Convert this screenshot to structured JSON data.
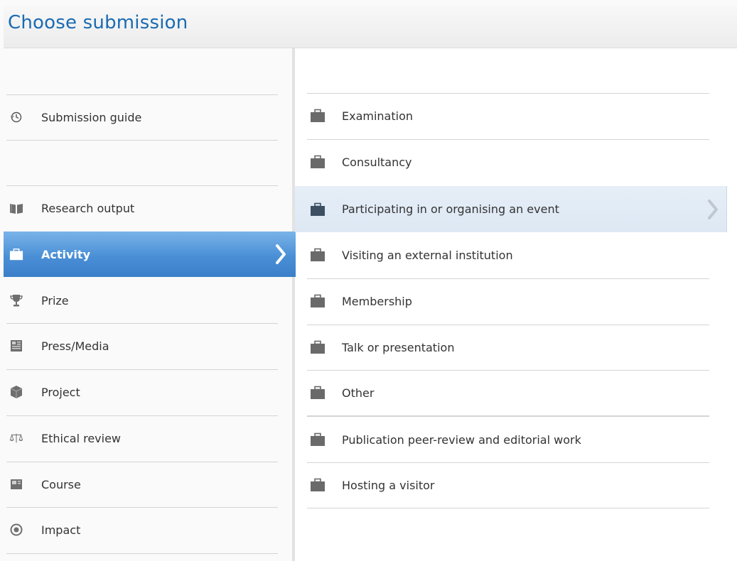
{
  "header": {
    "title": "Choose submission"
  },
  "left_menu": {
    "items": [
      {
        "label": "Submission guide",
        "icon": "clock-back-icon"
      },
      {
        "label": "Research output",
        "icon": "book-icon"
      },
      {
        "label": "Activity",
        "icon": "briefcase-icon",
        "active": true
      },
      {
        "label": "Prize",
        "icon": "trophy-icon"
      },
      {
        "label": "Press/Media",
        "icon": "newspaper-icon"
      },
      {
        "label": "Project",
        "icon": "cube-icon"
      },
      {
        "label": "Ethical review",
        "icon": "scales-icon"
      },
      {
        "label": "Course",
        "icon": "course-icon"
      },
      {
        "label": "Impact",
        "icon": "target-icon"
      }
    ]
  },
  "right_menu": {
    "items": [
      {
        "label": "Examination",
        "icon": "briefcase-icon"
      },
      {
        "label": "Consultancy",
        "icon": "briefcase-icon"
      },
      {
        "label": "Participating in or organising an event",
        "icon": "briefcase-icon",
        "hovered": true
      },
      {
        "label": "Visiting an external institution",
        "icon": "briefcase-icon"
      },
      {
        "label": "Membership",
        "icon": "briefcase-icon"
      },
      {
        "label": "Talk or presentation",
        "icon": "briefcase-icon"
      },
      {
        "label": "Other",
        "icon": "briefcase-icon"
      },
      {
        "label": "Publication peer-review and editorial work",
        "icon": "briefcase-icon"
      },
      {
        "label": "Hosting a visitor",
        "icon": "briefcase-icon"
      }
    ]
  },
  "colors": {
    "title": "#1a6bb3",
    "active_bg": "#4a8fd6",
    "hover_bg": "#dde8f4",
    "icon_gray": "#666666"
  }
}
